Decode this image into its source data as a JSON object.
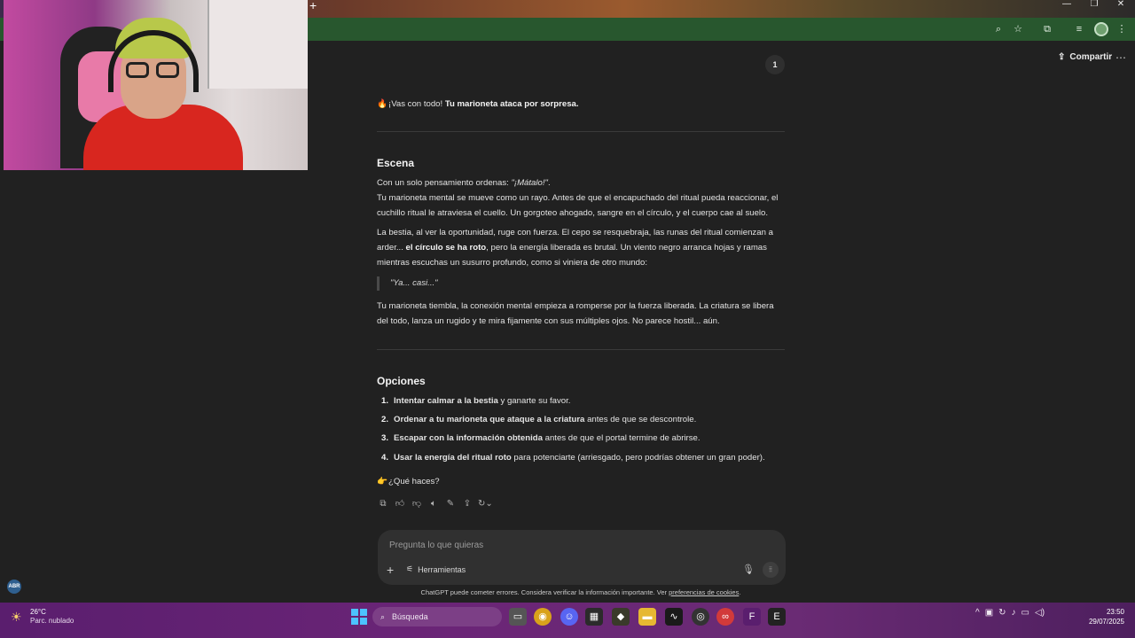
{
  "conversation": {
    "turn_number": "1",
    "share_label": "Compartir",
    "intro_emoji": "🔥",
    "intro_plain": "¡Vas con todo! ",
    "intro_bold": "Tu marioneta ataca por sorpresa.",
    "scene_heading": "Escena",
    "scene_p1_plain": "Con un solo pensamiento ordenas: ",
    "scene_p1_italic": "\"¡Mátalo!\"",
    "scene_p1_end": ".",
    "scene_p2": "Tu marioneta mental se mueve como un rayo. Antes de que el encapuchado del ritual pueda reaccionar, el cuchillo ritual le atraviesa el cuello. Un gorgoteo ahogado, sangre en el círculo, y el cuerpo cae al suelo.",
    "scene_p3_a": "La bestia, al ver la oportunidad, ruge con fuerza. El cepo se resquebraja, las runas del ritual comienzan a arder... ",
    "scene_p3_bold": "el círculo se ha roto",
    "scene_p3_b": ", pero la energía liberada es brutal. Un viento negro arranca hojas y ramas mientras escuchas un susurro profundo, como si viniera de otro mundo:",
    "quote": "\"Ya... casi...\"",
    "scene_p4": "Tu marioneta tiembla, la conexión mental empieza a romperse por la fuerza liberada. La criatura se libera del todo, lanza un rugido y te mira fijamente con sus múltiples ojos. No parece hostil... aún.",
    "options_heading": "Opciones",
    "options": [
      {
        "num": "1.",
        "bold": "Intentar calmar a la bestia",
        "rest": " y ganarte su favor."
      },
      {
        "num": "2.",
        "bold": "Ordenar a tu marioneta que ataque a la criatura",
        "rest": " antes de que se descontrole."
      },
      {
        "num": "3.",
        "bold": "Escapar con la información obtenida",
        "rest": " antes de que el portal termine de abrirse."
      },
      {
        "num": "4.",
        "bold": "Usar la energía del ritual roto",
        "rest": " para potenciarte (arriesgado, pero podrías obtener un gran poder)."
      }
    ],
    "question_emoji": "👉",
    "question": "¿Qué haces?"
  },
  "composer": {
    "placeholder": "Pregunta lo que quieras",
    "tools_label": "Herramientas"
  },
  "disclaimer": {
    "text": "ChatGPT puede cometer errores. Considera verificar la información importante. Ver ",
    "link": "preferencias de cookies",
    "end": "."
  },
  "overlay": {
    "badge": "ABR"
  },
  "taskbar": {
    "weather_temp": "26°C",
    "weather_cond": "Parc. nublado",
    "search_label": "Búsqueda",
    "time": "23:50",
    "date": "29/07/2025"
  },
  "colors": {
    "background": "#212121",
    "browser_toolbar": "#28572e",
    "composer": "#303030",
    "taskbar": "#6b2577",
    "windows_accent": "#4cc2ff"
  }
}
